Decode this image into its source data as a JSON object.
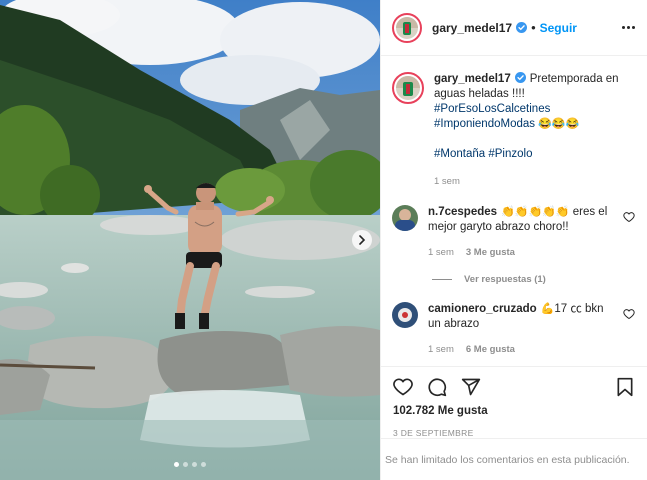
{
  "post": {
    "username": "gary_medel17",
    "follow_label": "Seguir",
    "separator": "•",
    "caption_text": "Pretemporada en aguas heladas !!!!",
    "hashtags_line1": "#PorEsoLosCalcetines",
    "hashtags_line2": "#ImponiendoModas",
    "hashtags_line2_emojis": "😂😂😂",
    "hashtag_montana": "#Montaña",
    "hashtag_pinzolo": "#Pinzolo",
    "caption_time": "1 sem",
    "likes_total": "102.782 Me gusta",
    "date": "3 DE SEPTIEMBRE",
    "comments_limited": "Se han limitado los comentarios en esta publicación."
  },
  "comments": [
    {
      "username": "n.7cespedes",
      "emojis": "👏👏👏👏👏",
      "text": "eres el mejor garyto abrazo choro!!",
      "time": "1 sem",
      "likes": "3 Me gusta",
      "view_replies": "Ver respuestas (1)"
    },
    {
      "username": "camionero_cruzado",
      "emojis": "💪",
      "text": "17 ㏄ bkn un abrazo",
      "time": "1 sem",
      "likes": "6 Me gusta"
    }
  ],
  "carousel": {
    "slides": 4,
    "active_slide": 1
  },
  "icons": [
    "verified-icon",
    "more-options-icon",
    "heart-icon",
    "comment-icon",
    "share-icon",
    "bookmark-icon",
    "chevron-right-icon"
  ],
  "colors": {
    "accent": "#0095f6",
    "hashtag": "#00376b",
    "muted": "#8e8e8e",
    "story_ring": "#e8415b"
  }
}
